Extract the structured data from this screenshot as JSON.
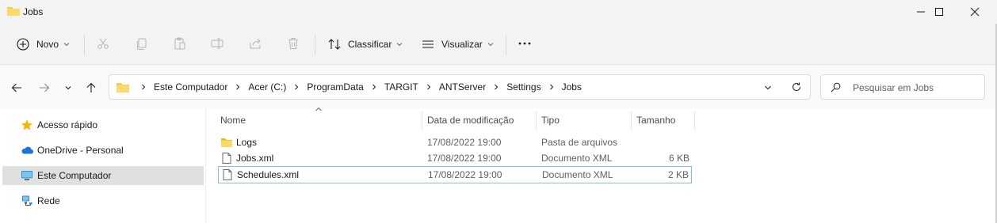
{
  "window": {
    "title": "Jobs",
    "controls": [
      "minimize",
      "maximize",
      "close"
    ]
  },
  "toolbar": {
    "new_label": "Novo",
    "sort_label": "Classificar",
    "view_label": "Visualizar",
    "icons": [
      "cut-icon",
      "copy-icon",
      "paste-icon",
      "rename-icon",
      "share-icon",
      "delete-icon",
      "more-icon"
    ]
  },
  "address": {
    "breadcrumbs": [
      "Este Computador",
      "Acer (C:)",
      "ProgramData",
      "TARGIT",
      "ANTServer",
      "Settings",
      "Jobs"
    ]
  },
  "search": {
    "placeholder": "Pesquisar em Jobs"
  },
  "sidebar": {
    "items": [
      {
        "label": "Acesso rápido",
        "icon": "star-icon"
      },
      {
        "label": "OneDrive - Personal",
        "icon": "cloud-icon"
      },
      {
        "label": "Este Computador",
        "icon": "computer-icon",
        "selected": true
      },
      {
        "label": "Rede",
        "icon": "network-icon"
      }
    ]
  },
  "columns": {
    "name": "Nome",
    "modified": "Data de modificação",
    "type": "Tipo",
    "size": "Tamanho"
  },
  "files": [
    {
      "name": "Logs",
      "modified": "17/08/2022 19:00",
      "type": "Pasta de arquivos",
      "size": "",
      "icon": "folder-icon"
    },
    {
      "name": "Jobs.xml",
      "modified": "17/08/2022 19:00",
      "type": "Documento XML",
      "size": "6 KB",
      "icon": "file-icon"
    },
    {
      "name": "Schedules.xml",
      "modified": "17/08/2022 19:00",
      "type": "Documento XML",
      "size": "2 KB",
      "icon": "file-icon",
      "focused": true
    }
  ],
  "colors": {
    "folder": "#f7c948",
    "accent": "#0067c0",
    "selected_bg": "#e0e0e0"
  }
}
